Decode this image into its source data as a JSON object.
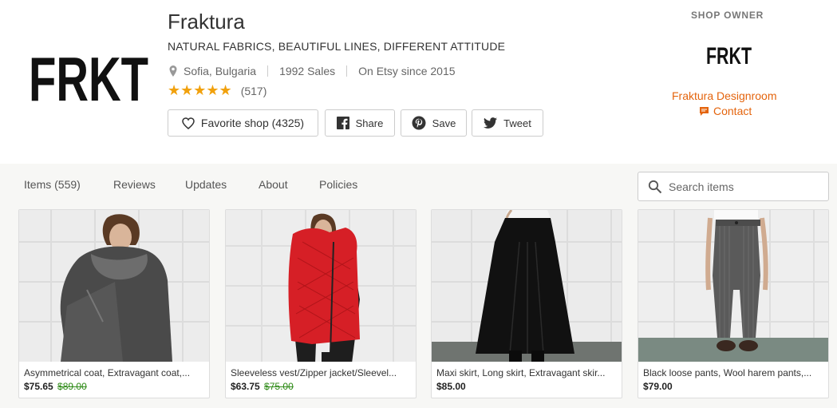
{
  "shop": {
    "logo_text": "FRKT",
    "name": "Fraktura",
    "tagline": "NATURAL FABRICS, BEAUTIFUL LINES, DIFFERENT ATTITUDE",
    "location": "Sofia, Bulgaria",
    "sales": "1992 Sales",
    "since": "On Etsy since 2015",
    "stars": "★★★★★",
    "rating_value": 5,
    "reviews_count": "(517)"
  },
  "actions": {
    "favorite_label": "Favorite shop (4325)",
    "share_label": "Share",
    "save_label": "Save",
    "tweet_label": "Tweet"
  },
  "owner": {
    "heading": "SHOP OWNER",
    "logo_text": "FRKT",
    "name": "Fraktura Designroom",
    "contact_label": "Contact"
  },
  "nav": {
    "tabs": [
      {
        "label": "Items (559)"
      },
      {
        "label": "Reviews"
      },
      {
        "label": "Updates"
      },
      {
        "label": "About"
      },
      {
        "label": "Policies"
      }
    ]
  },
  "search": {
    "placeholder": "Search items",
    "value": ""
  },
  "listings": [
    {
      "title": "Asymmetrical coat, Extravagant coat,...",
      "price": "$75.65",
      "original_price": "$89.00"
    },
    {
      "title": "Sleeveless vest/Zipper jacket/Sleevel...",
      "price": "$63.75",
      "original_price": "$75.00"
    },
    {
      "title": "Maxi skirt, Long skirt, Extravagant skir...",
      "price": "$85.00",
      "original_price": ""
    },
    {
      "title": "Black loose pants, Wool harem pants,...",
      "price": "$79.00",
      "original_price": ""
    }
  ],
  "colors": {
    "accent": "#e4640d",
    "star": "#f1a10d",
    "sale_price": "#2d8a16",
    "section_bg": "#f7f7f5"
  },
  "icons": {
    "location": "pin-icon",
    "favorite": "heart-icon",
    "share": "facebook-icon",
    "save": "pinterest-icon",
    "tweet": "twitter-icon",
    "contact": "message-icon",
    "search": "search-icon"
  }
}
